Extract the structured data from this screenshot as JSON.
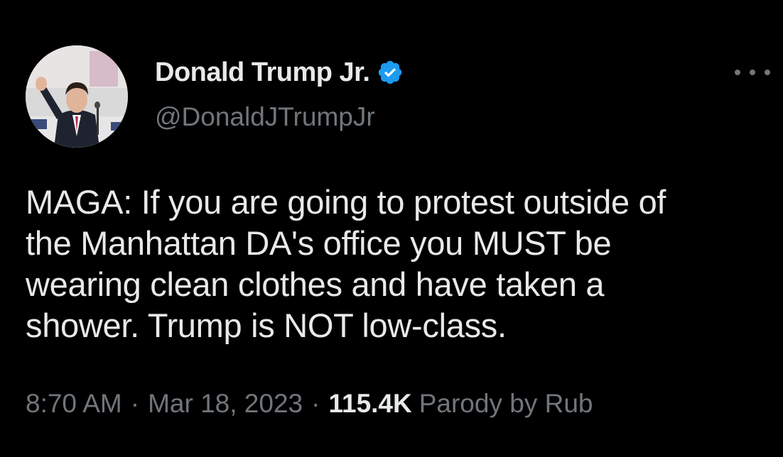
{
  "tweet": {
    "author": {
      "display_name": "Donald Trump Jr.",
      "handle": "@DonaldJTrumpJr",
      "verified": true,
      "avatar_icon": "profile-photo-avatar"
    },
    "text": "MAGA: If you are going to protest outside of\nthe Manhattan DA's office you MUST be\nwearing clean clothes and have taken a\nshower. Trump is NOT low-class.",
    "meta": {
      "time": "8:70 AM",
      "separator": "·",
      "date": "Mar 18, 2023",
      "views_count": "115.4K",
      "views_suffix": "Parody by Rub"
    }
  },
  "icons": {
    "verified": "verified-badge-icon",
    "more": "more-options-icon"
  },
  "colors": {
    "background": "#000000",
    "primary_text": "#e7e9ea",
    "secondary_text": "#71767b",
    "verified_blue": "#1d9bf0"
  }
}
